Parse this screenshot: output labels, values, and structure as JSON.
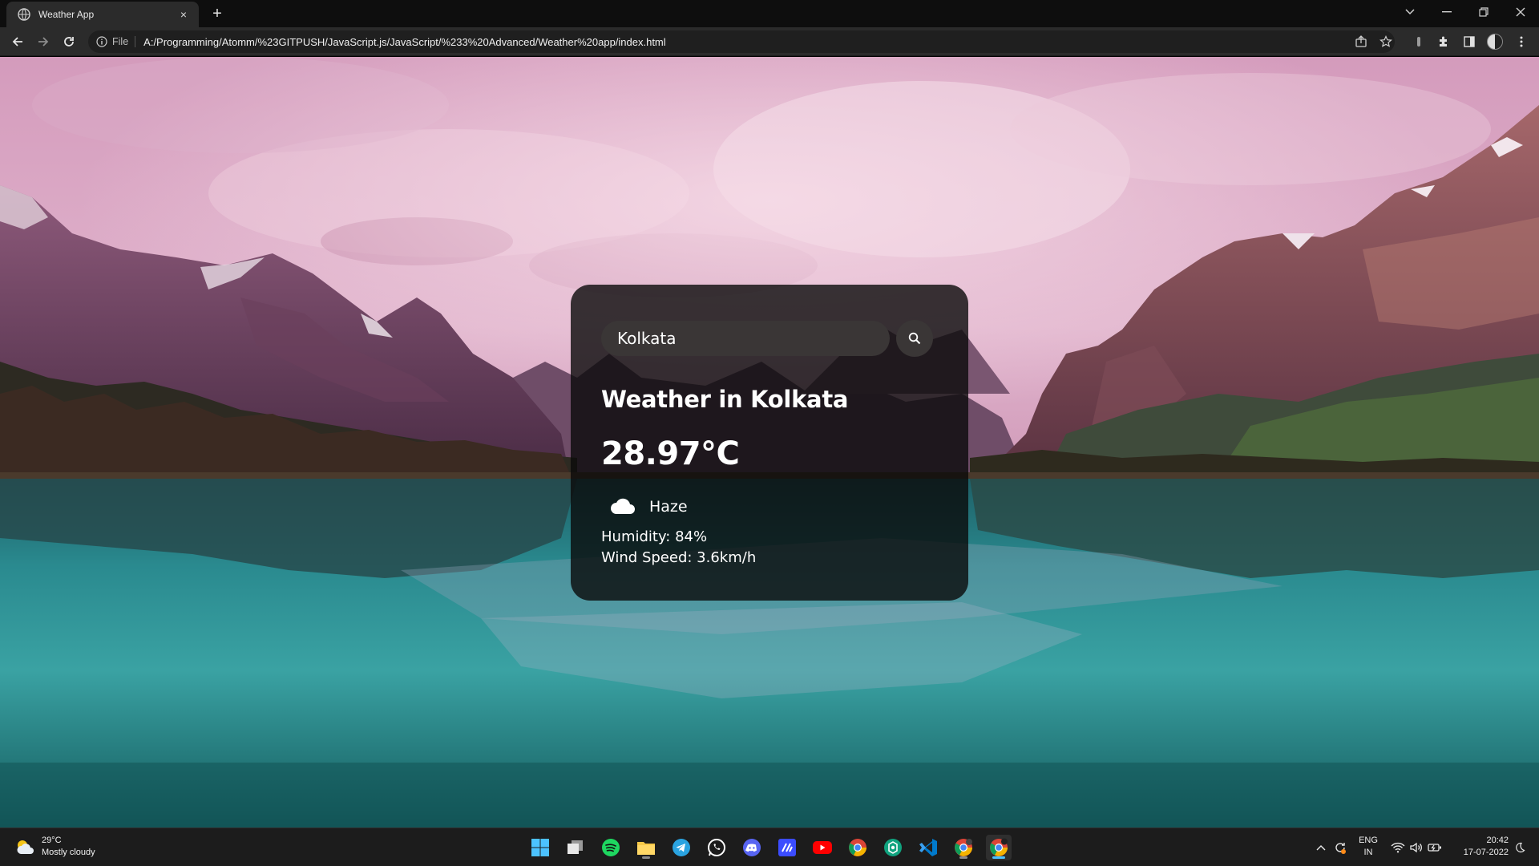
{
  "browser": {
    "tab_title": "Weather App",
    "tab_close": "×",
    "new_tab": "+",
    "scheme_label": "File",
    "url": "A:/Programming/Atomm/%23GITPUSH/JavaScript.js/JavaScript/%233%20Advanced/Weather%20app/index.html"
  },
  "weather": {
    "search_value": "Kolkata",
    "city_heading": "Weather in Kolkata",
    "temperature": "28.97°C",
    "description": "Haze",
    "humidity": "Humidity: 84%",
    "wind": "Wind Speed: 3.6km/h"
  },
  "taskbar": {
    "weather_temp": "29°C",
    "weather_desc": "Mostly cloudy",
    "lang_primary": "ENG",
    "lang_secondary": "IN",
    "time": "20:42",
    "date": "17-07-2022",
    "apps": [
      "start",
      "task-view",
      "spotify",
      "file-explorer",
      "telegram",
      "whatsapp",
      "discord",
      "notion-like",
      "youtube",
      "chrome",
      "chatgpt",
      "vscode",
      "chrome-profile",
      "chrome-active"
    ]
  },
  "colors": {
    "card_bg": "#0a0a0a",
    "input_bg": "#3a3636",
    "taskbar_bg": "#1c1c1c",
    "chrome_bar_bg": "#2b2b2b"
  }
}
